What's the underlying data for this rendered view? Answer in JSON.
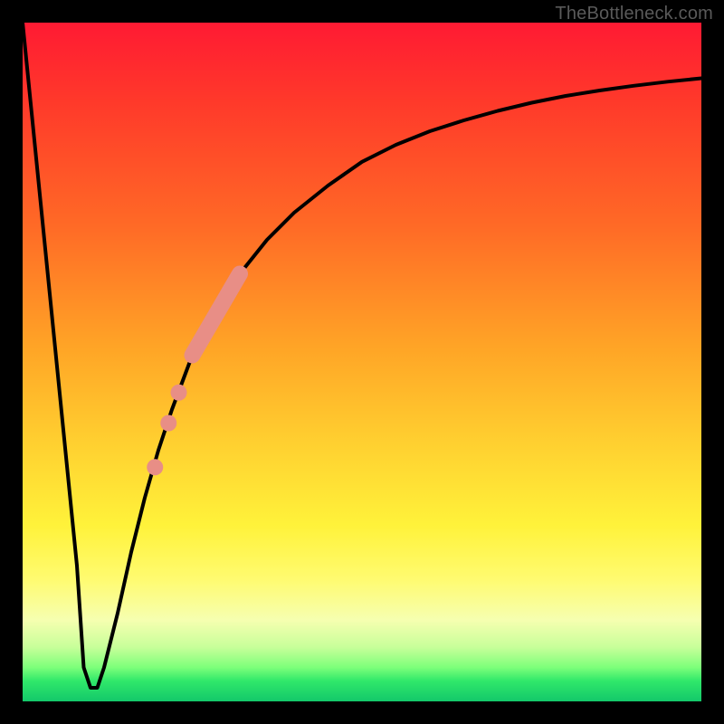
{
  "attribution": "TheBottleneck.com",
  "colors": {
    "frame": "#000000",
    "curve": "#000000",
    "marker": "#e88e86",
    "gradient_top": "#ff1a33",
    "gradient_bottom": "#13c86a"
  },
  "chart_data": {
    "type": "line",
    "title": "",
    "xlabel": "",
    "ylabel": "",
    "xlim": [
      0,
      100
    ],
    "ylim": [
      0,
      100
    ],
    "grid": false,
    "legend": false,
    "series": [
      {
        "name": "bottleneck-curve",
        "x": [
          0,
          2,
          4,
          6,
          8,
          9,
          10,
          11,
          12,
          14,
          16,
          18,
          20,
          22,
          25,
          28,
          32,
          36,
          40,
          45,
          50,
          55,
          60,
          65,
          70,
          75,
          80,
          85,
          90,
          95,
          100
        ],
        "y": [
          100,
          80,
          60,
          40,
          20,
          5,
          2,
          2,
          5,
          13,
          22,
          30,
          37,
          43,
          51,
          57,
          63,
          68,
          72,
          76,
          79.5,
          82,
          84,
          85.6,
          87,
          88.2,
          89.2,
          90,
          90.7,
          91.3,
          91.8
        ]
      }
    ],
    "flat_bottom": {
      "x_start": 9,
      "x_end": 11,
      "y": 2
    },
    "markers": {
      "name": "highlight-segment",
      "color": "#e88e86",
      "thick_segment": {
        "x_start": 25,
        "x_end": 32,
        "y_start": 51,
        "y_end": 63
      },
      "dots": [
        {
          "x": 23.0,
          "y": 45.5
        },
        {
          "x": 21.5,
          "y": 41.0
        },
        {
          "x": 19.5,
          "y": 34.5
        }
      ]
    }
  }
}
